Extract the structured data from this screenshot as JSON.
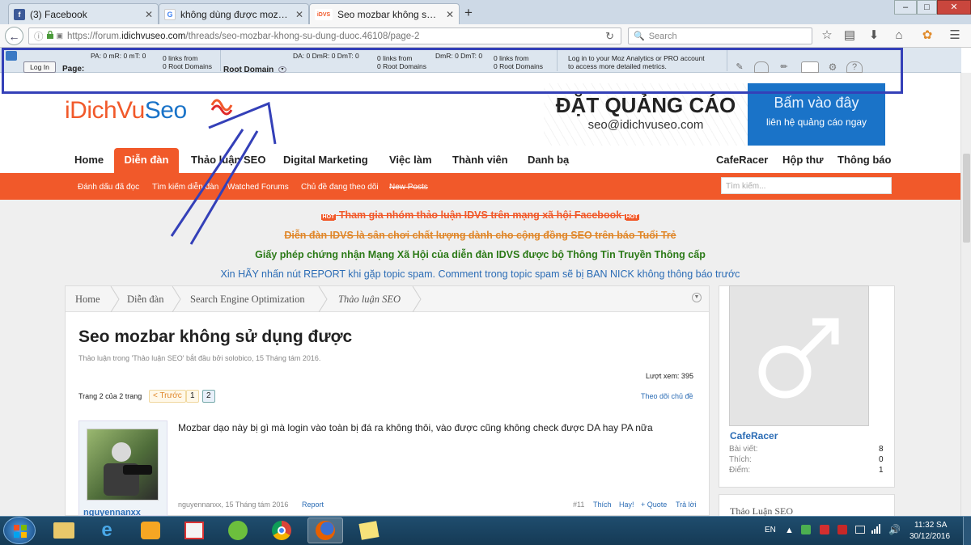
{
  "tabs": [
    {
      "title": "(3) Facebook",
      "fav": "f",
      "fav_color": "#3b5998"
    },
    {
      "title": "không dùng được mozbar ...",
      "fav": "G",
      "fav_color": "#4285f4"
    },
    {
      "title": "Seo mozbar không sử dụn...",
      "fav": "iDVS",
      "fav_color": "#f1592a"
    }
  ],
  "tab_new": "+",
  "window_controls": [
    "–",
    "□",
    "✕"
  ],
  "url": {
    "prefix": "https://forum.",
    "host": "idichvuseo.com",
    "path": "/threads/seo-mozbar-khong-su-dung-duoc.46108/page-2"
  },
  "search": {
    "placeholder": "Search"
  },
  "mozbar": {
    "login": "Log In",
    "page_label": "Page:",
    "page_metrics": "PA: 0    mR: 0    mT: 0",
    "page_links": "0 links from",
    "page_domains": "0 Root Domains",
    "root_label": "Root Domain",
    "root_metrics": "DA: 0    DmR: 0    DmT: 0",
    "root_links": "0 links from",
    "root_domains": "0 Root Domains",
    "sub_metrics": "DmR: 0    DmT: 0",
    "sub_links": "0 links from",
    "sub_domains": "0 Root Domains",
    "promo1": "Log in to your Moz Analytics or PRO account",
    "promo2": "to access more detailed metrics."
  },
  "site": {
    "logo_a": "iDichVu",
    "logo_b": "Seo",
    "banner_title": "ĐẶT QUẢNG CÁO",
    "banner_email": "seo@idichvuseo.com",
    "banner_cta": "Bấm vào đây",
    "banner_sub": "liên hệ quảng cáo ngay"
  },
  "nav": [
    "Home",
    "Diễn đàn",
    "Thảo luận SEO",
    "Digital Marketing",
    "Việc làm",
    "Thành viên",
    "Danh bạ"
  ],
  "nav_right": [
    "CafeRacer",
    "Hộp thư",
    "Thông báo"
  ],
  "subnav": [
    "Đánh dấu đã đọc",
    "Tìm kiếm diễn đàn",
    "Watched Forums",
    "Chủ đề đang theo dõi",
    "New Posts"
  ],
  "search_placeholder": "Tìm kiếm...",
  "notices": {
    "hot": "HOT",
    "n1": "Tham gia nhóm thảo luận IDVS trên mạng xã hội Facebook",
    "n2": "Diễn đàn IDVS là sân chơi chất lượng dành cho cộng đồng SEO trên báo Tuổi Trẻ",
    "n3": "Giấy phép chứng nhận Mạng Xã Hội của diễn đàn IDVS được bộ Thông Tin Truyền Thông cấp",
    "n4": "Xin HÃY nhấn nút REPORT khi gặp topic spam. Comment trong topic spam sẽ bị BAN NICK không thông báo trước"
  },
  "breadcrumb": [
    "Home",
    "Diễn đàn",
    "Search Engine Optimization",
    "Thảo luận SEO"
  ],
  "thread": {
    "title": "Seo mozbar không sử dụng được",
    "meta": "Thảo luận trong 'Thảo luận SEO' bắt đầu bởi solobico, 15 Tháng tám 2016.",
    "views": "Lượt xem: 395",
    "pages": "Trang 2 của 2 trang",
    "prev": "< Trước",
    "p1": "1",
    "p2": "2",
    "follow": "Theo dõi chủ đề"
  },
  "post": {
    "text": "Mozbar dạo này bị gì mà login vào toàn bị đá ra không thôi, vào được cũng không check được DA hay PA nữa",
    "author": "nguyennanxx",
    "date": "nguyennanxx, 15 Tháng tám 2016",
    "report": "Report",
    "num": "#11",
    "like": "Thích",
    "helpful": "Hay!",
    "quote": "+ Quote",
    "reply": "Trả lời"
  },
  "user": {
    "name": "CafeRacer",
    "stats": [
      {
        "k": "Bài viết:",
        "v": "8"
      },
      {
        "k": "Thích:",
        "v": "0"
      },
      {
        "k": "Điểm:",
        "v": "1"
      }
    ],
    "widget": "Thảo Luận SEO"
  },
  "taskbar": {
    "lang": "EN",
    "time": "11:32 SA",
    "date": "30/12/2016"
  },
  "colors": {
    "accent": "#f1592a",
    "link": "#2b6cb5",
    "highlight": "#3440b8"
  }
}
